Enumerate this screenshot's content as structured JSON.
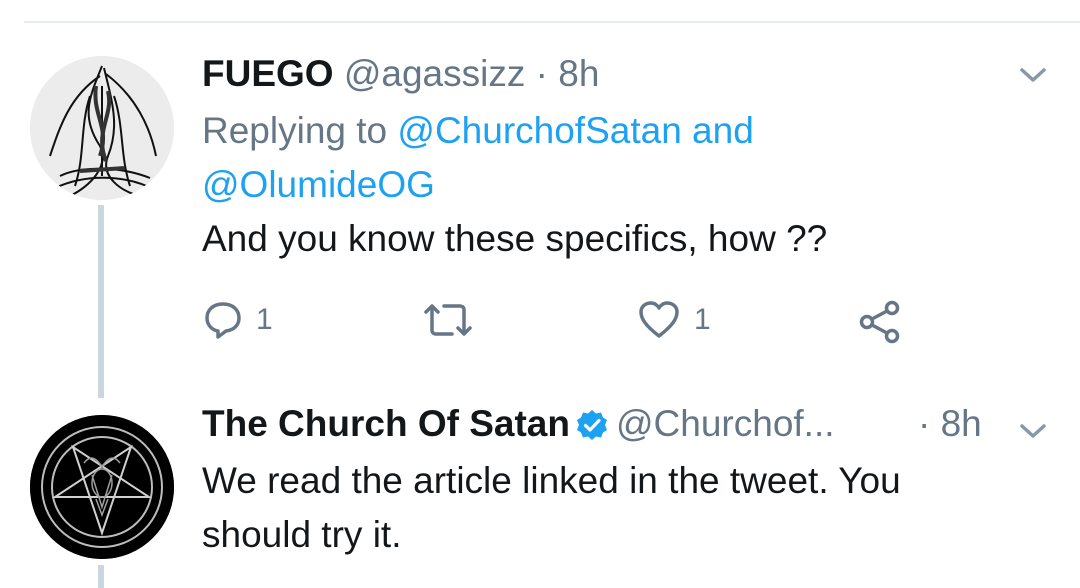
{
  "tweet1": {
    "display_name": "FUEGO",
    "handle": "@agassizz",
    "separator": " · ",
    "time": "8h",
    "replying_to_prefix": "Replying to ",
    "mention_1": "@ChurchofSatan",
    "mention_joiner": " and",
    "mention_2": "@OlumideOG",
    "text": "And you know these  specifics, how ??",
    "reply_count": "1",
    "retweet_count": "",
    "like_count": "1"
  },
  "tweet2": {
    "display_name": "The Church Of Satan",
    "handle": "@Churchof...",
    "separator": "· ",
    "time": "8h",
    "text_line1": "We read the article linked in the tweet. You",
    "text_line2": "should try it."
  },
  "icons": {
    "reply": "reply-icon",
    "retweet": "retweet-icon",
    "like": "heart-icon",
    "share": "share-icon",
    "caret": "chevron-down-icon",
    "verified": "verified-badge-icon"
  },
  "colors": {
    "link": "#1da1f2",
    "secondary_text": "#657786",
    "primary_text": "#14171a",
    "thread_line": "#ccd6dd"
  }
}
